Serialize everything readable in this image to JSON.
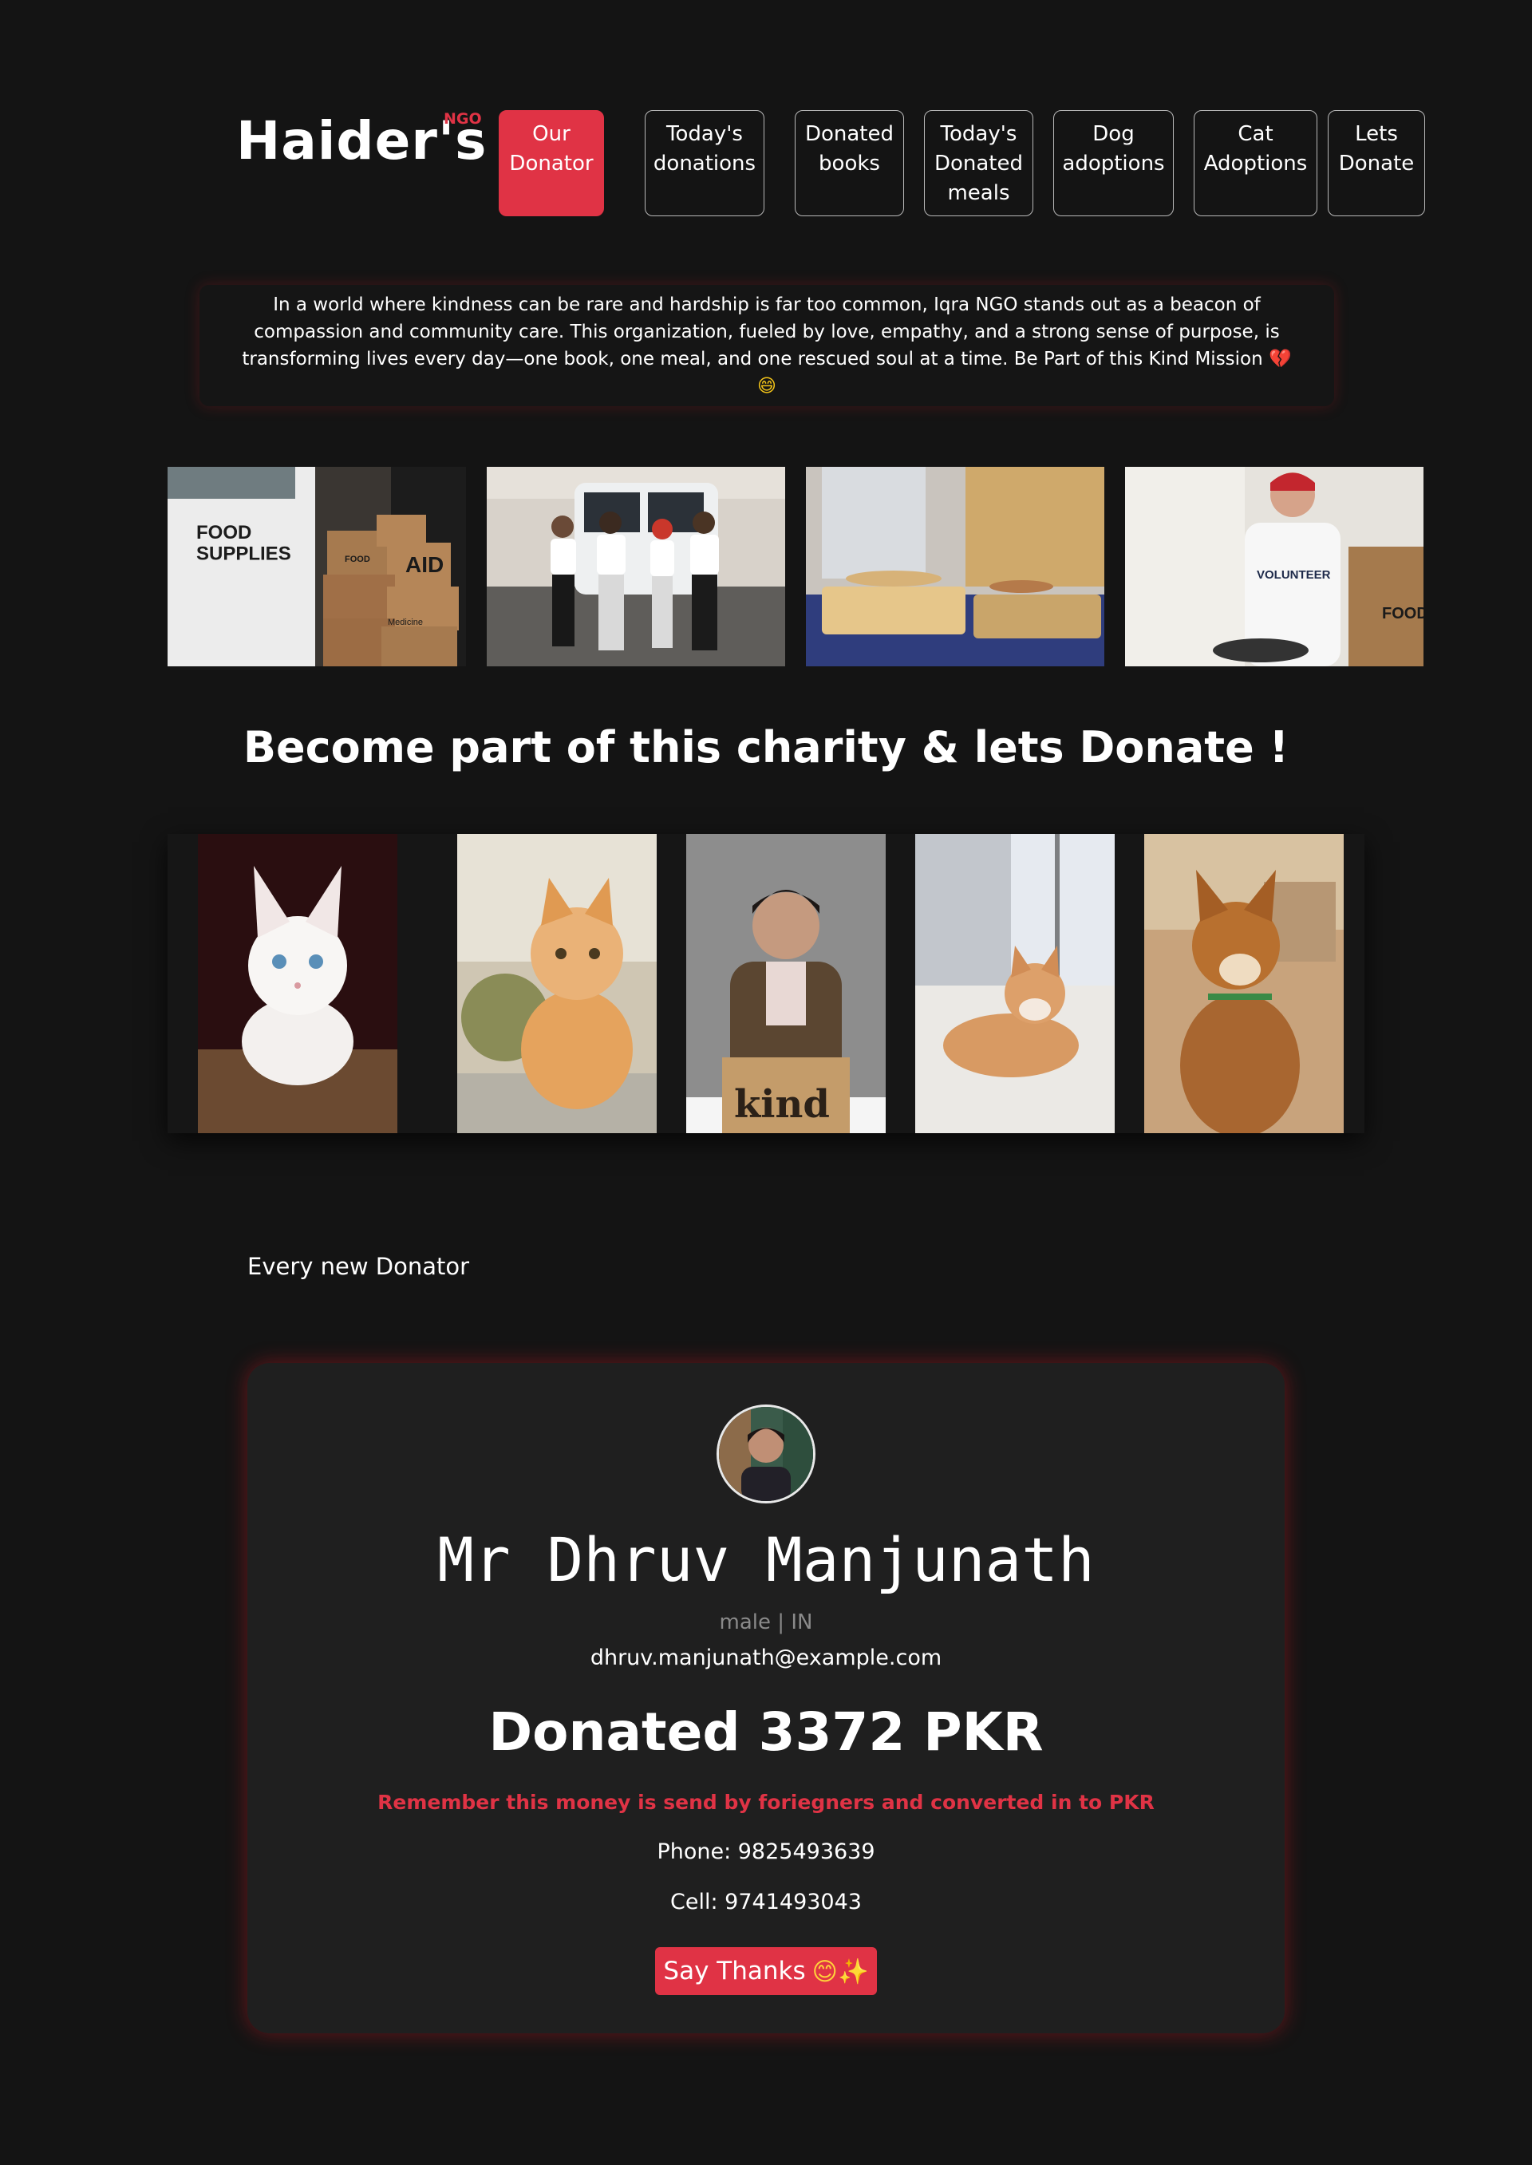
{
  "brand": {
    "name": "Haider's",
    "suffix": "NGO"
  },
  "nav": [
    {
      "label": "Our\nDonator",
      "active": true
    },
    {
      "label": "Today's\ndonations",
      "active": false
    },
    {
      "label": "Donated\nbooks",
      "active": false
    },
    {
      "label": "Today's\nDonated\nmeals",
      "active": false
    },
    {
      "label": "Dog\nadoptions",
      "active": false
    },
    {
      "label": "Cat\nAdoptions",
      "active": false
    },
    {
      "label": "Lets\nDonate",
      "active": false
    }
  ],
  "intro": {
    "text": "In a world where kindness can be rare and hardship is far too common, Iqra NGO stands out as a beacon of compassion and community care. This organization, fueled by love, empathy, and a strong sense of purpose, is transforming lives every day—one book, one meal, and one rescued soul at a time. Be Part of this Kind Mission",
    "emoji_heart": "💔",
    "emoji_smile": "😄"
  },
  "photo_strip_text": {
    "box_left": "FOOD\nSUPPLIES",
    "box_aid": "AID",
    "box_food": "FOOD",
    "box_medicine": "Medicine",
    "shirt_volunteer": "VOLUNTEER",
    "box_right": "FOOD"
  },
  "section_title": "Become part of this charity & lets Donate !",
  "gallery_box_text": "kind",
  "every_new_title": "Every new Donator",
  "donator": {
    "name": "Mr Dhruv Manjunath",
    "meta": "male | IN",
    "email": "dhruv.manjunath@example.com",
    "donated": "Donated 3372 PKR",
    "remember": "Remember this money is send by foriegners and converted in to PKR",
    "phone": "Phone: 9825493639",
    "cell": "Cell: 9741493043",
    "button_label": "Say Thanks",
    "button_emoji": "😊✨"
  },
  "colors": {
    "accent": "#e03345",
    "background": "#141414",
    "card": "#1f1f1f"
  }
}
